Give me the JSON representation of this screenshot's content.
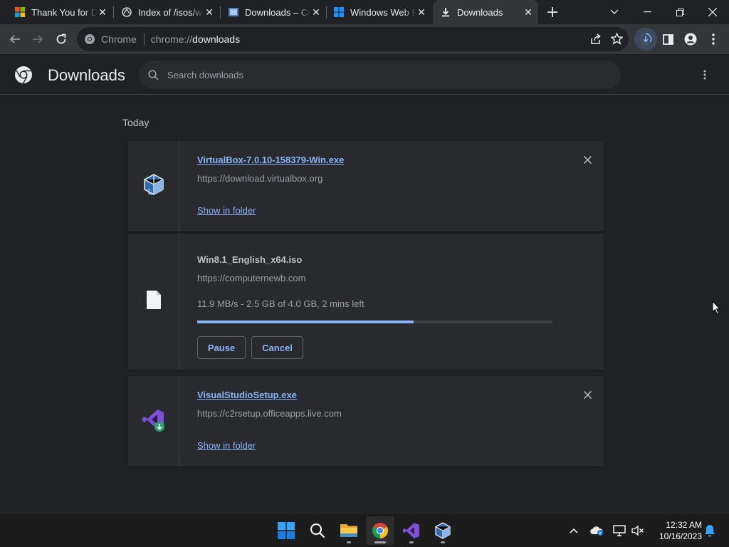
{
  "tabs": [
    {
      "title": "Thank You for Downloading",
      "favicon": "windows-logo-icon"
    },
    {
      "title": "Index of /isos/windows",
      "favicon": "site-icon"
    },
    {
      "title": "Downloads – ComputerNewb",
      "favicon": "site-icon"
    },
    {
      "title": "Windows Web Experience",
      "favicon": "windows-logo-icon"
    },
    {
      "title": "Downloads",
      "favicon": "download-icon",
      "active": true
    }
  ],
  "omnibox": {
    "chip": "Chrome",
    "scheme": "chrome://",
    "host": "downloads"
  },
  "header": {
    "title": "Downloads",
    "search_placeholder": "Search downloads"
  },
  "day_label": "Today",
  "downloads": [
    {
      "filename": "VirtualBox-7.0.10-158379-Win.exe",
      "source": "https://download.virtualbox.org",
      "action_link": "Show in folder",
      "icon": "virtualbox-icon"
    },
    {
      "filename": "Win8.1_English_x64.iso",
      "source": "https://computernewb.com",
      "status": "11.9 MB/s - 2.5 GB of 4.0 GB, 2 mins left",
      "progress": 0.61,
      "pause_label": "Pause",
      "cancel_label": "Cancel",
      "icon": "file-icon"
    },
    {
      "filename": "VisualStudioSetup.exe",
      "source": "https://c2rsetup.officeapps.live.com",
      "action_link": "Show in folder",
      "icon": "visual-studio-icon"
    }
  ],
  "taskbar": {
    "time": "12:32 AM",
    "date": "10/16/2023"
  },
  "colors": {
    "accent": "#8ab4f8",
    "background": "#202124",
    "card": "#292a2d"
  }
}
